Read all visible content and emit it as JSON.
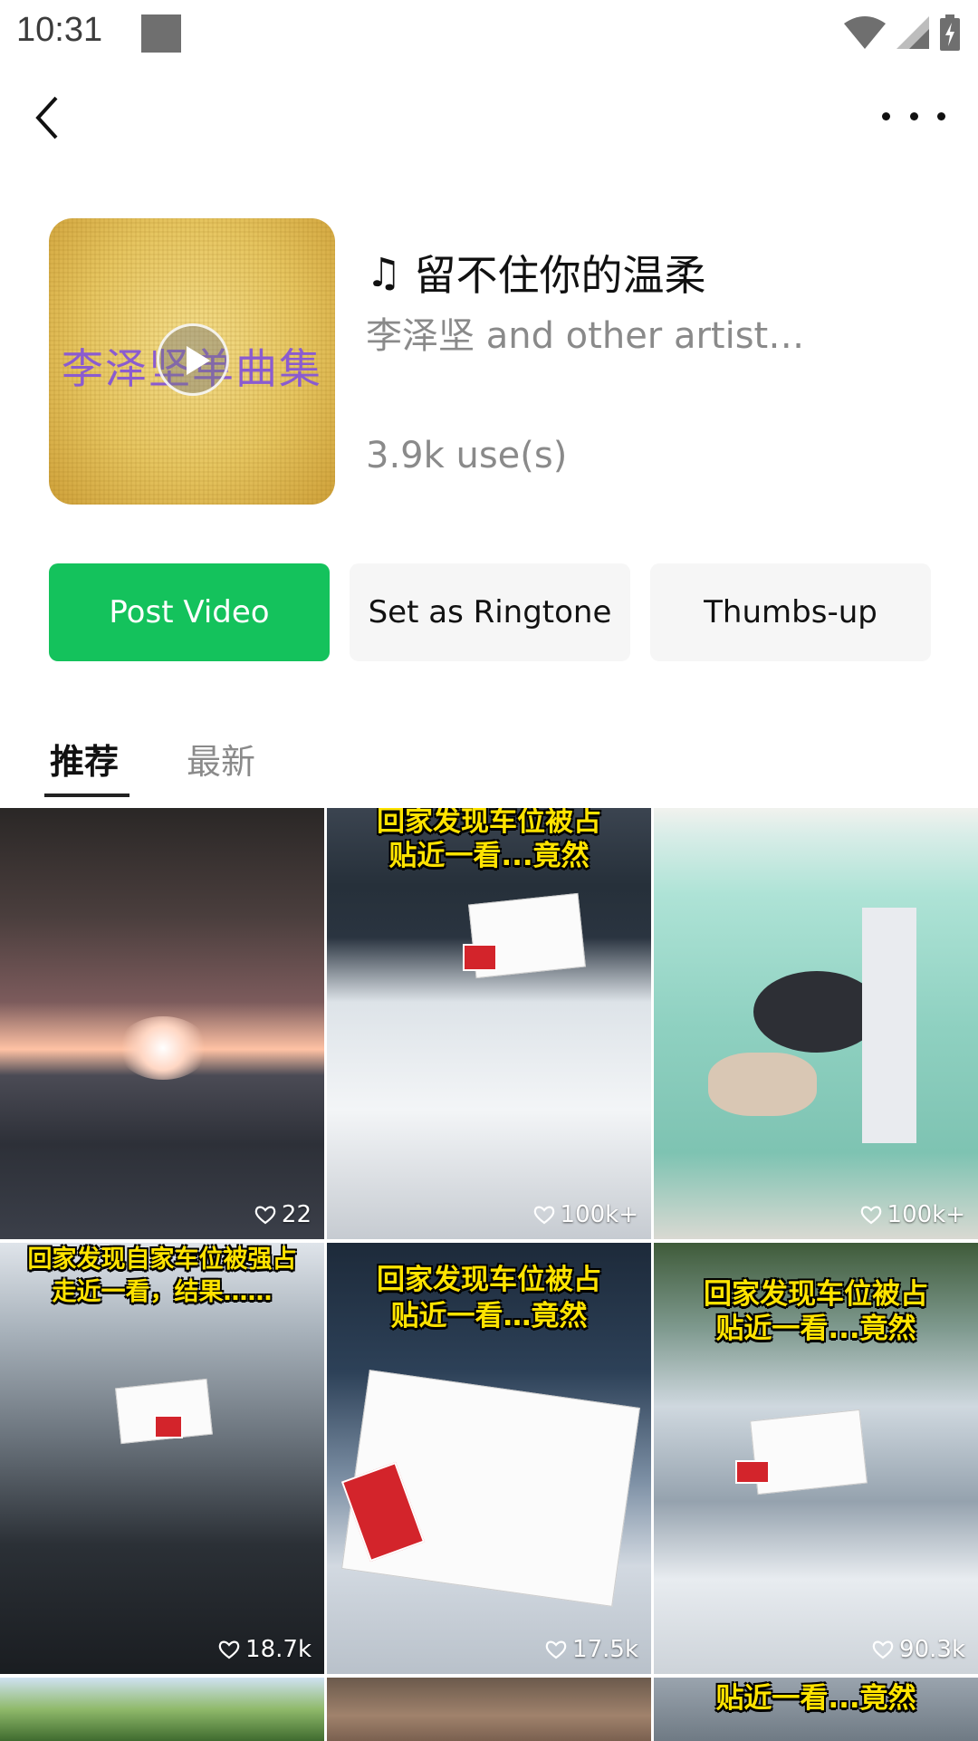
{
  "status_bar": {
    "time": "10:31"
  },
  "music": {
    "cover_text": "李泽坚单曲集",
    "title": "留不住你的温柔",
    "artist": "李泽坚 and other artists (…",
    "uses": "3.9k use(s)"
  },
  "actions": {
    "post_video": "Post Video",
    "set_ringtone": "Set as Ringtone",
    "thumbs_up": "Thumbs-up"
  },
  "tabs": [
    {
      "label": "推荐",
      "active": true
    },
    {
      "label": "最新",
      "active": false
    }
  ],
  "videos": [
    {
      "likes": "22",
      "caption": ""
    },
    {
      "likes": "100k+",
      "caption_line1": "回家发现车位被占",
      "caption_line2": "贴近一看...竟然"
    },
    {
      "likes": "100k+",
      "caption": ""
    },
    {
      "likes": "18.7k",
      "caption_line1": "回家发现自家车位被强占",
      "caption_line2": "走近一看，结果……"
    },
    {
      "likes": "17.5k",
      "caption_line1": "回家发现车位被占",
      "caption_line2": "贴近一看…竟然"
    },
    {
      "likes": "90.3k",
      "caption_line1": "回家发现车位被占",
      "caption_line2": "贴近一看...竟然"
    },
    {
      "likes": "",
      "caption": ""
    },
    {
      "likes": "",
      "caption": ""
    },
    {
      "likes": "",
      "caption_line2": "贴近一看...竟然"
    }
  ],
  "colors": {
    "primary_green": "#14c25c",
    "secondary_bg": "#f6f6f6",
    "muted_text": "#8a8a8a"
  }
}
